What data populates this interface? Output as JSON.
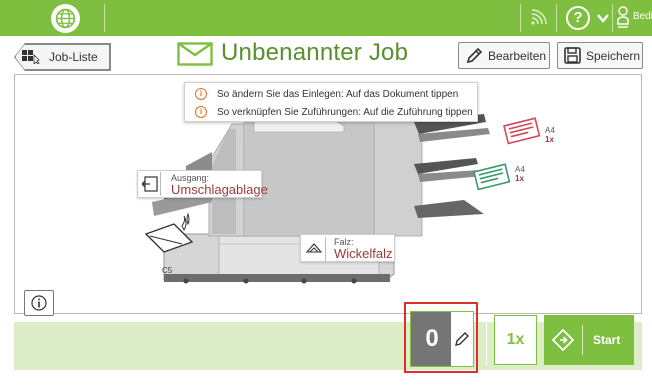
{
  "topbar": {
    "user_label": "Bediener",
    "help_label": "?",
    "globe_icon": "globe-icon",
    "signal_icon": "wifi-icon",
    "user_icon": "user-icon"
  },
  "header": {
    "back_label": "Job-Liste",
    "job_title": "Unbenannter Job",
    "edit_label": "Bearbeiten",
    "save_label": "Speichern"
  },
  "tips": [
    {
      "text": "So ändern Sie das Einlegen: Auf das Dokument tippen"
    },
    {
      "text": "So verknüpfen Sie Zuführungen: Auf die Zuführung tippen"
    }
  ],
  "machine": {
    "output_label": "Ausgang:",
    "output_value": "Umschlagablage",
    "fold_label": "Falz:",
    "fold_value": "Wickelfalz",
    "envelope_label": "C5",
    "feeder1": {
      "size": "A4",
      "count": "1x"
    },
    "feeder2": {
      "size": "A4",
      "count": "1x"
    }
  },
  "bottom": {
    "counter_value": "0",
    "multiplier": "1x",
    "start_label": "Start"
  },
  "colors": {
    "accent_green": "#7fbf3f",
    "title_green": "#5a8f2e",
    "highlight_red": "#d9302c",
    "bottom_bg": "#dcedc8",
    "label_red": "#9a3a3a"
  }
}
